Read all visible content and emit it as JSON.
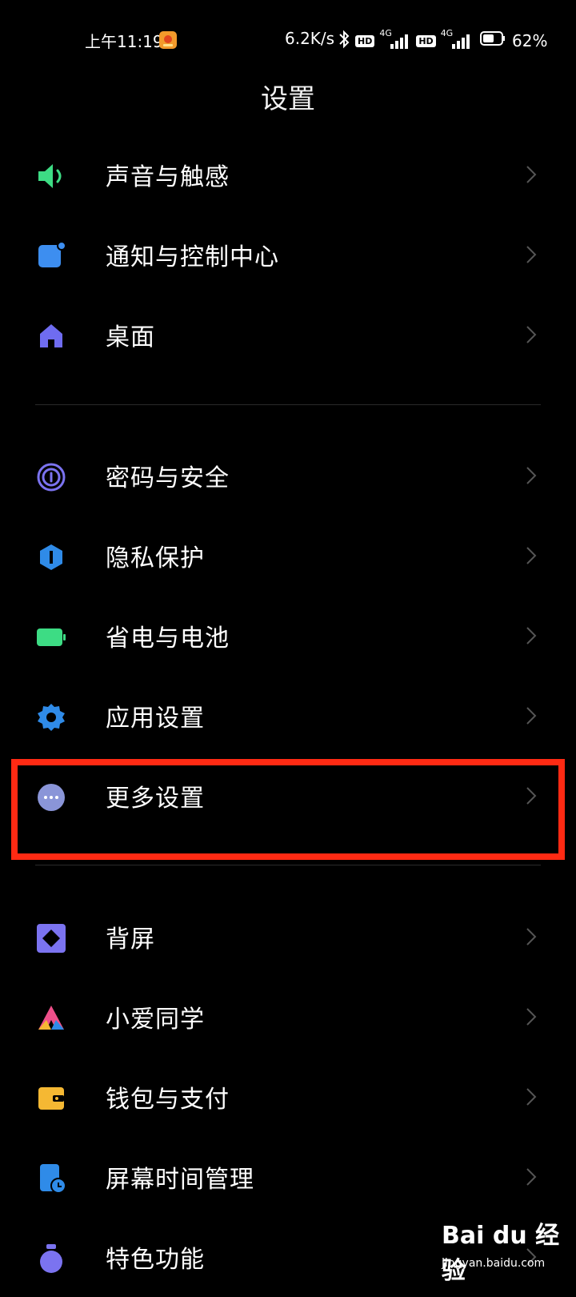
{
  "status_bar": {
    "time": "上午11:19",
    "net_speed": "6.2K/s",
    "hd1": "HD",
    "net1": "4G",
    "hd2": "HD",
    "net2": "4G",
    "battery_percent": "62%",
    "battery_level": 0.62
  },
  "page": {
    "title": "设置"
  },
  "items": [
    {
      "label": "声音与触感",
      "icon": "speaker-icon",
      "color": "#3ddc84"
    },
    {
      "label": "通知与控制中心",
      "icon": "notification-icon",
      "color": "#3d8ef0"
    },
    {
      "label": "桌面",
      "icon": "home-icon",
      "color": "#6f6cf0"
    },
    {
      "label": "密码与安全",
      "icon": "fingerprint-icon",
      "color": "#7b73f0"
    },
    {
      "label": "隐私保护",
      "icon": "privacy-shield-icon",
      "color": "#2f8be8"
    },
    {
      "label": "省电与电池",
      "icon": "battery-icon",
      "color": "#3ddc84"
    },
    {
      "label": "应用设置",
      "icon": "gear-icon",
      "color": "#2f8be8"
    },
    {
      "label": "更多设置",
      "icon": "more-dots-icon",
      "color": "#8a95d8"
    },
    {
      "label": "背屏",
      "icon": "rear-screen-icon",
      "color": "#7b73f0"
    },
    {
      "label": "小爱同学",
      "icon": "xiaoai-icon",
      "color": "#f0a23a"
    },
    {
      "label": "钱包与支付",
      "icon": "wallet-icon",
      "color": "#f5b833"
    },
    {
      "label": "屏幕时间管理",
      "icon": "screen-time-icon",
      "color": "#2f8be8"
    },
    {
      "label": "特色功能",
      "icon": "feature-icon",
      "color": "#7b73f0"
    }
  ],
  "watermark": {
    "main": "Bai du 经验",
    "sub": "jingyan.baidu.com"
  },
  "colors": {
    "highlight": "#ff2a13",
    "background": "#000000"
  }
}
